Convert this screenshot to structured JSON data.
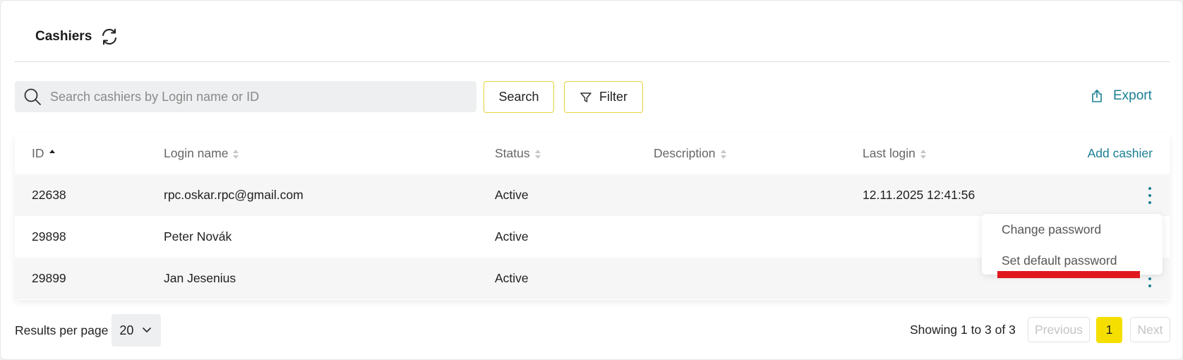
{
  "header": {
    "title": "Cashiers",
    "refresh_icon": "refresh-icon"
  },
  "toolbar": {
    "search_placeholder": "Search cashiers by Login name or ID",
    "search_value": "",
    "search_label": "Search",
    "filter_label": "Filter",
    "export_label": "Export"
  },
  "table": {
    "columns": [
      "ID",
      "Login name",
      "Status",
      "Description",
      "Last login"
    ],
    "add_label": "Add cashier",
    "rows": [
      {
        "id": "22638",
        "login": "rpc.oskar.rpc@gmail.com",
        "status": "Active",
        "description": "",
        "last_login": "12.11.2025 12:41:56"
      },
      {
        "id": "29898",
        "login": "Peter Novák",
        "status": "Active",
        "description": "",
        "last_login": ""
      },
      {
        "id": "29899",
        "login": "Jan Jesenius",
        "status": "Active",
        "description": "",
        "last_login": ""
      }
    ]
  },
  "context_menu": {
    "items": [
      "Change password",
      "Set default password"
    ]
  },
  "footer": {
    "results_per_page_label": "Results per page",
    "results_per_page_value": "20",
    "showing": "Showing 1 to 3 of 3",
    "previous": "Previous",
    "current_page": "1",
    "next": "Next"
  },
  "colors": {
    "accent": "#1a7f93",
    "highlight": "#f5df00",
    "outline": "#e6d33a",
    "annotation": "#e0191f"
  }
}
